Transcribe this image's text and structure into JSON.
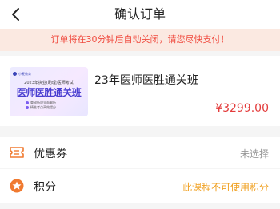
{
  "header": {
    "title": "确认订单",
    "back_icon": "chevron-left-icon"
  },
  "notice": {
    "text": "订单将在30分钟后自动关闭，请您尽快支付！",
    "color": "#f04a3e",
    "background": "#fbe9e1"
  },
  "course": {
    "name": "23年医师医胜通关班",
    "price": "¥3299.00",
    "price_color": "#e33b3b",
    "thumbnail": {
      "brand": "小麦教育",
      "subtitle": "2023年执业(助理)医师考试",
      "headline": "医师医胜通关班",
      "features": [
        "重磅新课全面解析",
        "精准考点高效提分"
      ]
    }
  },
  "coupon": {
    "label": "优惠券",
    "value": "未选择",
    "icon": "ticket-icon"
  },
  "points": {
    "label": "积分",
    "value": "此课程不可使用积分",
    "value_color": "#f0a020",
    "icon": "points-star-icon"
  },
  "accent_color": "#f07a30"
}
